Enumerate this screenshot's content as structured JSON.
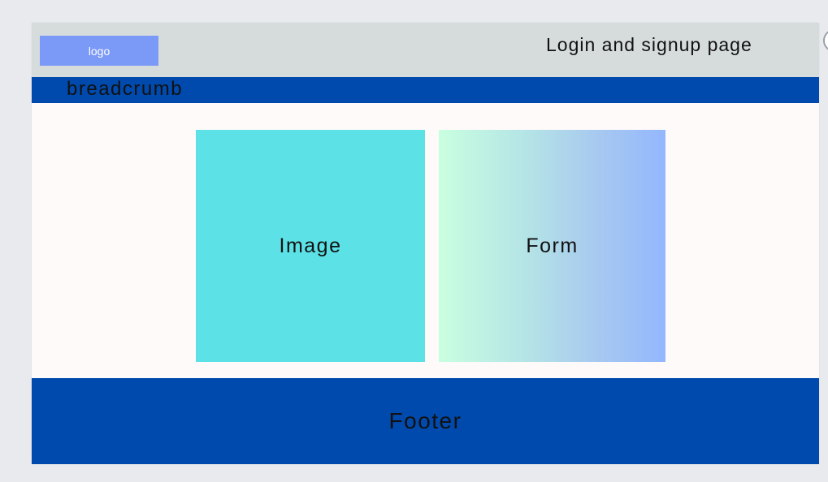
{
  "header": {
    "logo_label": "logo",
    "title": "Login and signup page"
  },
  "breadcrumb": {
    "label": "breadcrumb"
  },
  "main": {
    "image_label": "Image",
    "form_label": "Form"
  },
  "footer": {
    "label": "Footer"
  },
  "colors": {
    "page_background": "#e9eaee",
    "canvas_background": "#fffafa",
    "header_background": "#d6dcdb",
    "logo_background": "#7b99f6",
    "primary_blue": "#004aad",
    "image_panel": "#5ce1e6",
    "form_gradient_start": "#c9ffe0",
    "form_gradient_end": "#93b7fd"
  }
}
